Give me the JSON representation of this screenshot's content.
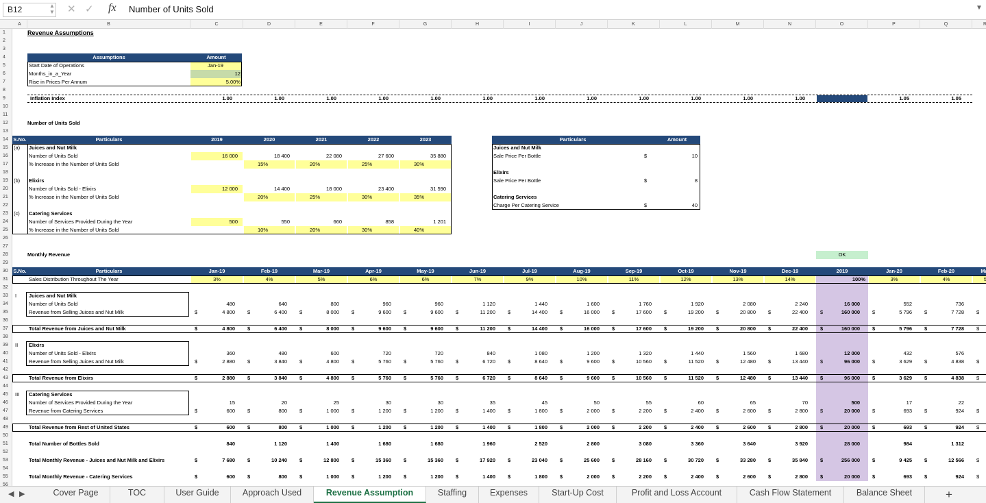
{
  "formula_bar": {
    "cell_ref": "B12",
    "content": "Number of Units Sold",
    "fx": "fx"
  },
  "columns": [
    "A",
    "B",
    "C",
    "D",
    "E",
    "F",
    "G",
    "H",
    "I",
    "J",
    "K",
    "L",
    "M",
    "N",
    "O",
    "P",
    "Q",
    "R"
  ],
  "sheet": {
    "title": "Revenue Assumptions",
    "assumptions": {
      "header": [
        "Assumptions",
        "Amount"
      ],
      "rows": [
        {
          "label": "Start Date of Operations",
          "value": "Jan-19"
        },
        {
          "label": "Months_in_a_Year",
          "value": "12"
        },
        {
          "label": "Rise in Prices Per Annum",
          "value": "5.00%"
        }
      ]
    },
    "inflation": {
      "label": "Inflation Index",
      "values": [
        "1.00",
        "1.00",
        "1.00",
        "1.00",
        "1.00",
        "1.00",
        "1.00",
        "1.00",
        "1.00",
        "1.00",
        "1.00",
        "1.00",
        "",
        "1.05",
        "1.05"
      ]
    },
    "units_title": "Number of Units Sold",
    "units_table": {
      "headers": [
        "S.No.",
        "Particulars",
        "2019",
        "2020",
        "2021",
        "2022",
        "2023"
      ],
      "rows": [
        {
          "sno": "(a)",
          "label": "Juices and Nut Milk",
          "bold": true,
          "vals": [
            "",
            "",
            "",
            "",
            ""
          ]
        },
        {
          "sno": "",
          "label": "Number of Units Sold",
          "vals": [
            "16 000",
            "18 400",
            "22 080",
            "27 600",
            "35 880"
          ]
        },
        {
          "sno": "",
          "label": "% Increase in  the Number of Units Sold",
          "vals": [
            "",
            "15%",
            "20%",
            "25%",
            "30%"
          ]
        },
        {
          "sno": "",
          "label": "",
          "vals": [
            "",
            "",
            "",
            "",
            ""
          ]
        },
        {
          "sno": "(b)",
          "label": "Elixirs",
          "bold": true,
          "vals": [
            "",
            "",
            "",
            "",
            ""
          ]
        },
        {
          "sno": "",
          "label": "Number of Units Sold - Elixirs",
          "vals": [
            "12 000",
            "14 400",
            "18 000",
            "23 400",
            "31 590"
          ]
        },
        {
          "sno": "",
          "label": "% Increase in  the Number of Units Sold",
          "vals": [
            "",
            "20%",
            "25%",
            "30%",
            "35%"
          ]
        },
        {
          "sno": "",
          "label": "",
          "vals": [
            "",
            "",
            "",
            "",
            ""
          ]
        },
        {
          "sno": "(c)",
          "label": "Catering Services",
          "bold": true,
          "vals": [
            "",
            "",
            "",
            "",
            ""
          ]
        },
        {
          "sno": "",
          "label": "Number of Services Provided During the Year",
          "vals": [
            "500",
            "550",
            "660",
            "858",
            "1 201"
          ]
        },
        {
          "sno": "",
          "label": "% Increase in  the Number of Units Sold",
          "vals": [
            "",
            "10%",
            "20%",
            "30%",
            "40%"
          ]
        }
      ]
    },
    "price_table": {
      "headers": [
        "Particulars",
        "Amount"
      ],
      "rows": [
        {
          "label": "Juices and Nut Milk",
          "bold": true,
          "cur": "",
          "amt": ""
        },
        {
          "label": "Sale Price Per Bottle",
          "cur": "$",
          "amt": "10"
        },
        {
          "label": "",
          "cur": "",
          "amt": ""
        },
        {
          "label": "Elixirs",
          "bold": true,
          "cur": "",
          "amt": ""
        },
        {
          "label": "Sale Price Per Bottle",
          "cur": "$",
          "amt": "8"
        },
        {
          "label": "",
          "cur": "",
          "amt": ""
        },
        {
          "label": "Catering Services",
          "bold": true,
          "cur": "",
          "amt": ""
        },
        {
          "label": "Charge Per Catering Service",
          "cur": "$",
          "amt": "40"
        }
      ]
    },
    "monthly_title": "Monthly Revenue",
    "ok_label": "OK",
    "monthly": {
      "headers": [
        "S.No.",
        "Particulars",
        "Jan-19",
        "Feb-19",
        "Mar-19",
        "Apr-19",
        "May-19",
        "Jun-19",
        "Jul-19",
        "Aug-19",
        "Sep-19",
        "Oct-19",
        "Nov-19",
        "Dec-19",
        "2019",
        "Jan-20",
        "Feb-20",
        "Mar"
      ],
      "dist_label": "Sales Distribution Throughout The Year",
      "dist": [
        "3%",
        "4%",
        "5%",
        "6%",
        "6%",
        "7%",
        "9%",
        "10%",
        "11%",
        "12%",
        "13%",
        "14%",
        "100%",
        "3%",
        "4%",
        "5"
      ],
      "rows": [
        {
          "row": 33,
          "sno": "I",
          "label": "Juices and Nut Milk",
          "bold": true
        },
        {
          "row": 34,
          "label": "Number of Units Sold",
          "vals": [
            "480",
            "640",
            "800",
            "960",
            "960",
            "1 120",
            "1 440",
            "1 600",
            "1 760",
            "1 920",
            "2 080",
            "2 240",
            "16 000",
            "552",
            "736"
          ]
        },
        {
          "row": 35,
          "label": "Revenue from Selling Juices and Nut Milk",
          "cur": true,
          "vals": [
            "4 800",
            "6 400",
            "8 000",
            "9 600",
            "9 600",
            "11 200",
            "14 400",
            "16 000",
            "17 600",
            "19 200",
            "20 800",
            "22 400",
            "160 000",
            "5 796",
            "7 728"
          ]
        },
        {
          "row": 37,
          "label": "Total Revenue from Juices and Nut Milk",
          "bold": true,
          "total": true,
          "cur": true,
          "vals": [
            "4 800",
            "6 400",
            "8 000",
            "9 600",
            "9 600",
            "11 200",
            "14 400",
            "16 000",
            "17 600",
            "19 200",
            "20 800",
            "22 400",
            "160 000",
            "5 796",
            "7 728"
          ]
        },
        {
          "row": 39,
          "sno": "II",
          "label": "Elixirs",
          "bold": true
        },
        {
          "row": 40,
          "label": "Number of Units Sold - Elixirs",
          "vals": [
            "360",
            "480",
            "600",
            "720",
            "720",
            "840",
            "1 080",
            "1 200",
            "1 320",
            "1 440",
            "1 560",
            "1 680",
            "12 000",
            "432",
            "576"
          ]
        },
        {
          "row": 41,
          "label": "Revenue from Selling Juices and Nut Milk",
          "cur": true,
          "vals": [
            "2 880",
            "3 840",
            "4 800",
            "5 760",
            "5 760",
            "6 720",
            "8 640",
            "9 600",
            "10 560",
            "11 520",
            "12 480",
            "13 440",
            "96 000",
            "3 629",
            "4 838"
          ]
        },
        {
          "row": 43,
          "label": "Total Revenue from Elixirs",
          "bold": true,
          "total": true,
          "cur": true,
          "vals": [
            "2 880",
            "3 840",
            "4 800",
            "5 760",
            "5 760",
            "6 720",
            "8 640",
            "9 600",
            "10 560",
            "11 520",
            "12 480",
            "13 440",
            "96 000",
            "3 629",
            "4 838"
          ]
        },
        {
          "row": 45,
          "sno": "III",
          "label": "Catering Services",
          "bold": true
        },
        {
          "row": 46,
          "label": "Number of Services Provided During the Year",
          "vals": [
            "15",
            "20",
            "25",
            "30",
            "30",
            "35",
            "45",
            "50",
            "55",
            "60",
            "65",
            "70",
            "500",
            "17",
            "22"
          ]
        },
        {
          "row": 47,
          "label": "Revenue from Catering Services",
          "cur": true,
          "vals": [
            "600",
            "800",
            "1 000",
            "1 200",
            "1 200",
            "1 400",
            "1 800",
            "2 000",
            "2 200",
            "2 400",
            "2 600",
            "2 800",
            "20 000",
            "693",
            "924"
          ]
        },
        {
          "row": 49,
          "label": "Total Revenue from Rest of United States",
          "bold": true,
          "total": true,
          "cur": true,
          "vals": [
            "600",
            "800",
            "1 000",
            "1 200",
            "1 200",
            "1 400",
            "1 800",
            "2 000",
            "2 200",
            "2 400",
            "2 600",
            "2 800",
            "20 000",
            "693",
            "924"
          ]
        },
        {
          "row": 51,
          "label": "Total Number of Bottles Sold",
          "bold": true,
          "vals": [
            "840",
            "1 120",
            "1 400",
            "1 680",
            "1 680",
            "1 960",
            "2 520",
            "2 800",
            "3 080",
            "3 360",
            "3 640",
            "3 920",
            "28 000",
            "984",
            "1 312"
          ]
        },
        {
          "row": 53,
          "label": "Total Monthly Revenue - Juices and Nut Milk and Elixirs",
          "bold": true,
          "cur": true,
          "vals": [
            "7 680",
            "10 240",
            "12 800",
            "15 360",
            "15 360",
            "17 920",
            "23 040",
            "25 600",
            "28 160",
            "30 720",
            "33 280",
            "35 840",
            "256 000",
            "9 425",
            "12 566"
          ]
        },
        {
          "row": 55,
          "label": "Total Monthly Revenue - Catering Services",
          "bold": true,
          "cur": true,
          "vals": [
            "600",
            "800",
            "1 000",
            "1 200",
            "1 200",
            "1 400",
            "1 800",
            "2 000",
            "2 200",
            "2 400",
            "2 600",
            "2 800",
            "20 000",
            "693",
            "924"
          ]
        }
      ]
    }
  },
  "tabs": [
    "Cover Page",
    "TOC",
    "User Guide",
    "Approach Used",
    "Revenue Assumption",
    "Staffing",
    "Expenses",
    "Start-Up Cost",
    "Profit and Loss Account",
    "Cash Flow Statement",
    "Balance Sheet"
  ],
  "active_tab": "Revenue Assumption",
  "colors": {
    "header_blue": "#24497a",
    "input_yellow": "#ffff99",
    "annual_purple": "#d5c6e4",
    "ok_green": "#c6efce",
    "active_tab_green": "#1e7145"
  }
}
